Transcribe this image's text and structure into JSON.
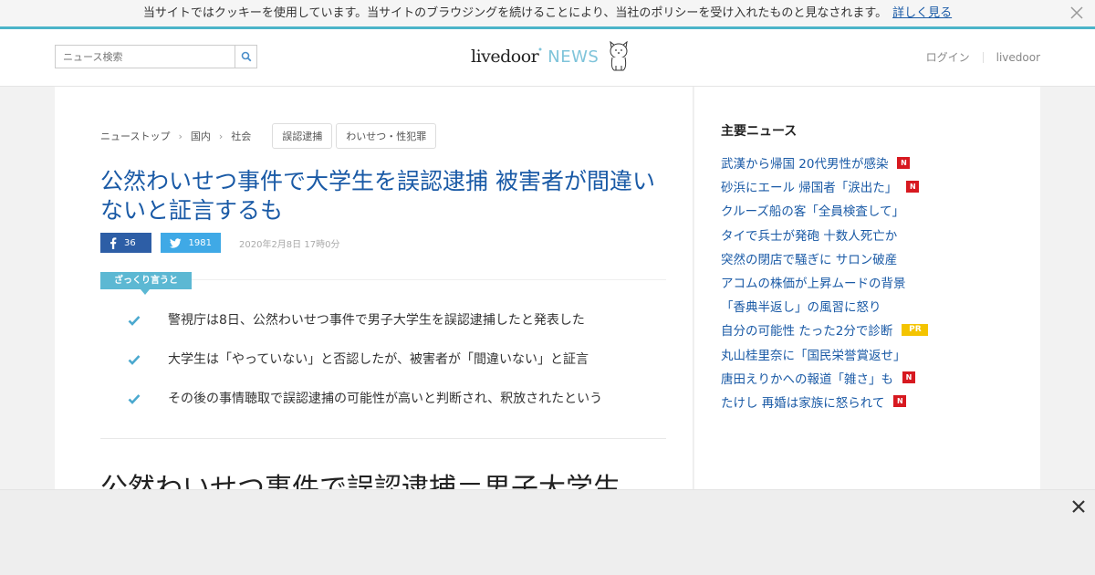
{
  "cookie_bar": {
    "text": "当サイトではクッキーを使用しています。当サイトのブラウジングを続けることにより、当社のポリシーを受け入れたものと見なされます。",
    "link": "詳しく見る",
    "close_icon": "close-icon"
  },
  "header": {
    "search_placeholder": "ニュース検索",
    "search_icon": "search-icon",
    "logo_livedoor": "livedoor",
    "logo_news": "NEWS",
    "login": "ログイン",
    "livedoor_link": "livedoor"
  },
  "breadcrumb": {
    "items": [
      "ニューストップ",
      "国内",
      "社会"
    ],
    "tags": [
      "誤認逮捕",
      "わいせつ・性犯罪"
    ]
  },
  "article": {
    "title": "公然わいせつ事件で大学生を誤認逮捕 被害者が間違いないと証言するも",
    "facebook_count": "36",
    "twitter_count": "1981",
    "date": "2020年2月8日 17時0分",
    "summary_label": "ざっくり言うと",
    "summary": [
      "警視庁は8日、公然わいせつ事件で男子大学生を誤認逮捕したと発表した",
      "大学生は「やっていない」と否認したが、被害者が「間違いない」と証言",
      "その後の事情聴取で誤認逮捕の可能性が高いと判断され、釈放されたという"
    ],
    "sub_heading": "公然わいせつ事件で誤認逮捕＝男子大学生"
  },
  "sidebar": {
    "title": "主要ニュース",
    "news": [
      {
        "text": "武漢から帰国 20代男性が感染",
        "badge": "N"
      },
      {
        "text": "砂浜にエール 帰国者「涙出た」",
        "badge": "N"
      },
      {
        "text": "クルーズ船の客「全員検査して」",
        "badge": ""
      },
      {
        "text": "タイで兵士が発砲 十数人死亡か",
        "badge": ""
      },
      {
        "text": "突然の閉店で騒ぎに サロン破産",
        "badge": ""
      },
      {
        "text": "アコムの株価が上昇ムードの背景",
        "badge": ""
      },
      {
        "text": "「香典半返し」の風習に怒り",
        "badge": ""
      },
      {
        "text": "自分の可能性 たった2分で診断",
        "badge": "PR"
      },
      {
        "text": "丸山桂里奈に「国民栄誉賞返せ」",
        "badge": ""
      },
      {
        "text": "唐田えりかへの報道「雑さ」も",
        "badge": "N"
      },
      {
        "text": "たけし 再婚は家族に怒られて",
        "badge": "N"
      }
    ]
  },
  "colors": {
    "accent": "#4bb4c9",
    "link": "#1a5aa6",
    "facebook": "#2d5ea6",
    "twitter": "#3fa9e6",
    "badge_new": "#d71920",
    "badge_pr": "#f4c400"
  }
}
